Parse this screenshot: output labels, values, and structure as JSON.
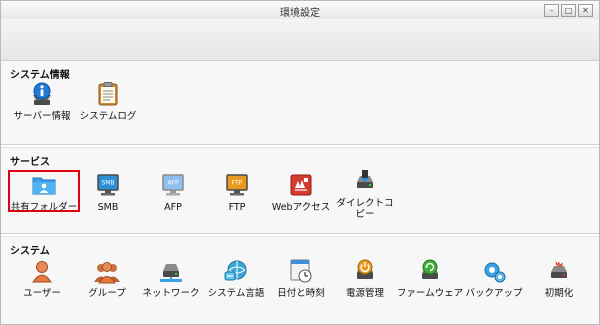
{
  "window": {
    "title": "環境設定",
    "minimize_glyph": "–",
    "maximize_glyph": "□",
    "close_glyph": "✕"
  },
  "sections": {
    "system_info": {
      "title": "システム情報",
      "items": [
        {
          "label": "サーバー情報",
          "icon": "server-info-icon"
        },
        {
          "label": "システムログ",
          "icon": "system-log-icon"
        }
      ]
    },
    "services": {
      "title": "サービス",
      "items": [
        {
          "label": "共有フォルダー",
          "icon": "shared-folder-icon",
          "selected": true
        },
        {
          "label": "SMB",
          "icon": "smb-icon",
          "badge": "SMB"
        },
        {
          "label": "AFP",
          "icon": "afp-icon",
          "badge": "AFP"
        },
        {
          "label": "FTP",
          "icon": "ftp-icon",
          "badge": "FTP"
        },
        {
          "label": "Webアクセス",
          "icon": "web-access-icon"
        },
        {
          "label": "ダイレクトコピー",
          "icon": "direct-copy-icon"
        }
      ]
    },
    "system": {
      "title": "システム",
      "items": [
        {
          "label": "ユーザー",
          "icon": "user-icon"
        },
        {
          "label": "グループ",
          "icon": "group-icon"
        },
        {
          "label": "ネットワーク",
          "icon": "network-icon"
        },
        {
          "label": "システム言語",
          "icon": "language-icon"
        },
        {
          "label": "日付と時刻",
          "icon": "clock-icon"
        },
        {
          "label": "電源管理",
          "icon": "power-icon"
        },
        {
          "label": "ファームウェア",
          "icon": "firmware-icon"
        },
        {
          "label": "バックアップ",
          "icon": "backup-icon"
        },
        {
          "label": "初期化",
          "icon": "initialize-icon"
        }
      ]
    }
  },
  "colors": {
    "selection_border": "#e0000f",
    "accent_blue": "#2a8fe0",
    "icon_orange": "#e59a26",
    "icon_red": "#d63b2f"
  }
}
